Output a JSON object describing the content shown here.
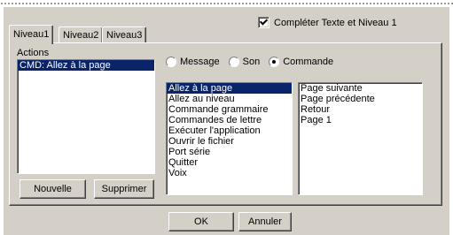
{
  "checkbox": {
    "label": "Compléter Texte et Niveau 1",
    "checked": true
  },
  "tabs": [
    {
      "label": "Niveau1",
      "active": true
    },
    {
      "label": "Niveau2",
      "active": false
    },
    {
      "label": "Niveau3",
      "active": false
    }
  ],
  "actions": {
    "label": "Actions",
    "items": [
      "CMD: Allez à la page"
    ],
    "selected_index": 0,
    "new_button": "Nouvelle",
    "delete_button": "Supprimer"
  },
  "type_options": [
    {
      "label": "Message",
      "selected": false
    },
    {
      "label": "Son",
      "selected": false
    },
    {
      "label": "Commande",
      "selected": true
    }
  ],
  "commands": {
    "items": [
      "Allez à la page",
      "Allez au niveau",
      "Commande grammaire",
      "Commandes de lettre",
      "Exécuter l'application",
      "Ouvrir le fichier",
      "Port série",
      "Quitter",
      "Voix"
    ],
    "selected_index": 0
  },
  "params": {
    "items": [
      "Page suivante",
      "Page précédente",
      "Retour",
      "Page 1"
    ]
  },
  "footer": {
    "ok": "OK",
    "cancel": "Annuler"
  }
}
